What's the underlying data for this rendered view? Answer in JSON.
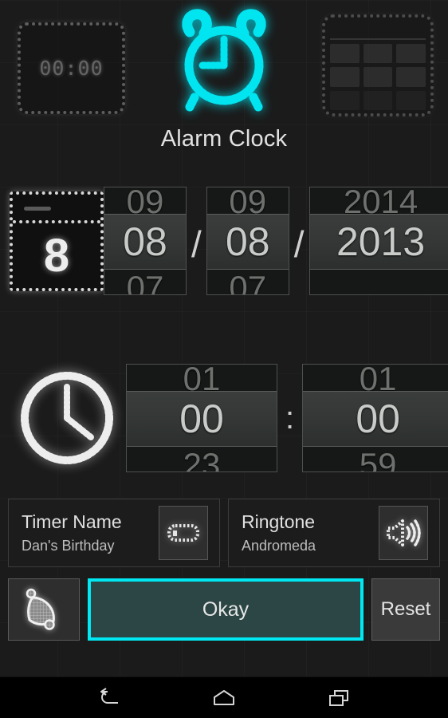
{
  "app": {
    "title": "Alarm Clock"
  },
  "header": {
    "icons": [
      {
        "name": "digital-clock-icon",
        "label": "00:00"
      },
      {
        "name": "alarm-clock-icon",
        "label": "alarm-clock",
        "color": "#00e5f0"
      },
      {
        "name": "calendar-grid-icon",
        "label": "calendar-grid"
      }
    ]
  },
  "date_picker": {
    "icon_label": "8",
    "month": {
      "prev": "09",
      "selected": "08",
      "next": "07"
    },
    "day": {
      "prev": "09",
      "selected": "08",
      "next": "07"
    },
    "year": {
      "prev": "2014",
      "selected": "2013",
      "next": ""
    },
    "separator": "/"
  },
  "time_picker": {
    "hour": {
      "prev": "01",
      "selected": "00",
      "next": "23"
    },
    "minute": {
      "prev": "01",
      "selected": "00",
      "next": "59"
    },
    "separator": ":"
  },
  "fields": {
    "timer_name": {
      "label": "Timer Name",
      "value": "Dan's Birthday",
      "icon": "text-field-icon"
    },
    "ringtone": {
      "label": "Ringtone",
      "value": "Andromeda",
      "icon": "speaker-icon"
    }
  },
  "buttons": {
    "bell": {
      "label": "bell-icon"
    },
    "okay": {
      "label": "Okay",
      "focus_color": "#00e9f2",
      "fill_color": "#2b4644"
    },
    "reset": {
      "label": "Reset"
    }
  },
  "navbar": {
    "back": "back-icon",
    "home": "home-icon",
    "recents": "recents-icon"
  }
}
